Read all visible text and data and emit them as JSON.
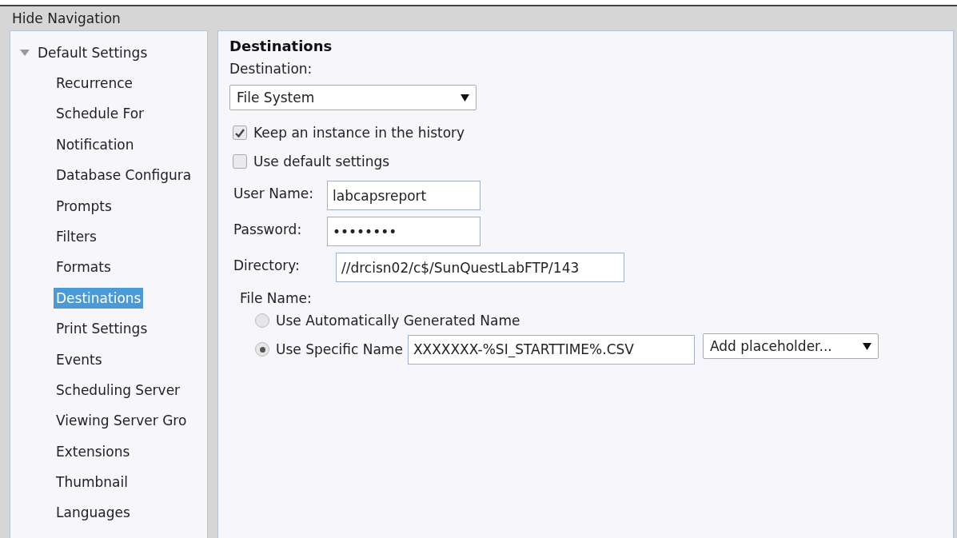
{
  "header": {
    "title": "Hide Navigation"
  },
  "sidebar": {
    "group": {
      "label": "Default Settings",
      "expanded": true,
      "children": [
        {
          "label": "Recurrence",
          "selected": false
        },
        {
          "label": "Schedule For",
          "selected": false
        },
        {
          "label": "Notification",
          "selected": false
        },
        {
          "label": "Database Configura",
          "selected": false
        },
        {
          "label": "Prompts",
          "selected": false
        },
        {
          "label": "Filters",
          "selected": false
        },
        {
          "label": "Formats",
          "selected": false
        },
        {
          "label": "Destinations",
          "selected": true
        },
        {
          "label": "Print Settings",
          "selected": false
        },
        {
          "label": "Events",
          "selected": false
        },
        {
          "label": "Scheduling Server",
          "selected": false
        },
        {
          "label": "Viewing Server Gro",
          "selected": false
        },
        {
          "label": "Extensions",
          "selected": false
        },
        {
          "label": "Thumbnail",
          "selected": false
        },
        {
          "label": "Languages",
          "selected": false
        }
      ]
    }
  },
  "main": {
    "title": "Destinations",
    "destination_label": "Destination:",
    "destination_value": "File System",
    "checkboxes": [
      {
        "label": "Keep an instance in the history",
        "checked": true
      },
      {
        "label": "Use default settings",
        "checked": false
      }
    ],
    "fields": [
      {
        "label": "User Name:",
        "value": "labcapsreport",
        "kind": "short"
      },
      {
        "label": "Password:",
        "value": "••••••••",
        "kind": "short"
      },
      {
        "label": "Directory:",
        "value": "//drcisn02/c$/SunQuestLabFTP/143",
        "kind": "long"
      }
    ],
    "file_name_label": "File Name:",
    "radios": [
      {
        "label": "Use Automatically Generated Name",
        "selected": false
      },
      {
        "label": "Use Specific Name",
        "selected": true,
        "value": "XXXXXXX-%SI_STARTTIME%.CSV",
        "placeholder_menu": "Add placeholder..."
      }
    ]
  }
}
